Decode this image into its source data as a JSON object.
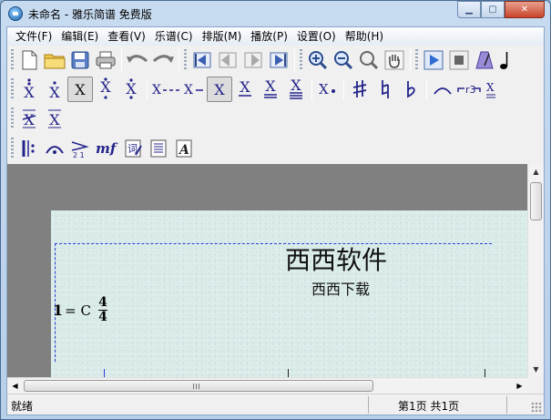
{
  "window": {
    "title": "未命名 - 雅乐简谱 免费版",
    "min_label": "▁",
    "max_label": "▢",
    "close_label": "✕"
  },
  "menu": [
    {
      "label": "文件(F)"
    },
    {
      "label": "编辑(E)"
    },
    {
      "label": "查看(V)"
    },
    {
      "label": "乐谱(C)"
    },
    {
      "label": "排版(M)"
    },
    {
      "label": "播放(P)"
    },
    {
      "label": "设置(O)"
    },
    {
      "label": "帮助(H)"
    }
  ],
  "document": {
    "title": "西西软件",
    "subtitle": "西西下载",
    "key_number": "1",
    "key_text": "= C",
    "time_top": "4",
    "time_bottom": "4"
  },
  "status": {
    "left": "就绪",
    "page": "第1页 共1页"
  },
  "colors": {
    "accent": "#23238a",
    "paper": "#d9ebe9",
    "dashed": "#2a3ad0"
  }
}
